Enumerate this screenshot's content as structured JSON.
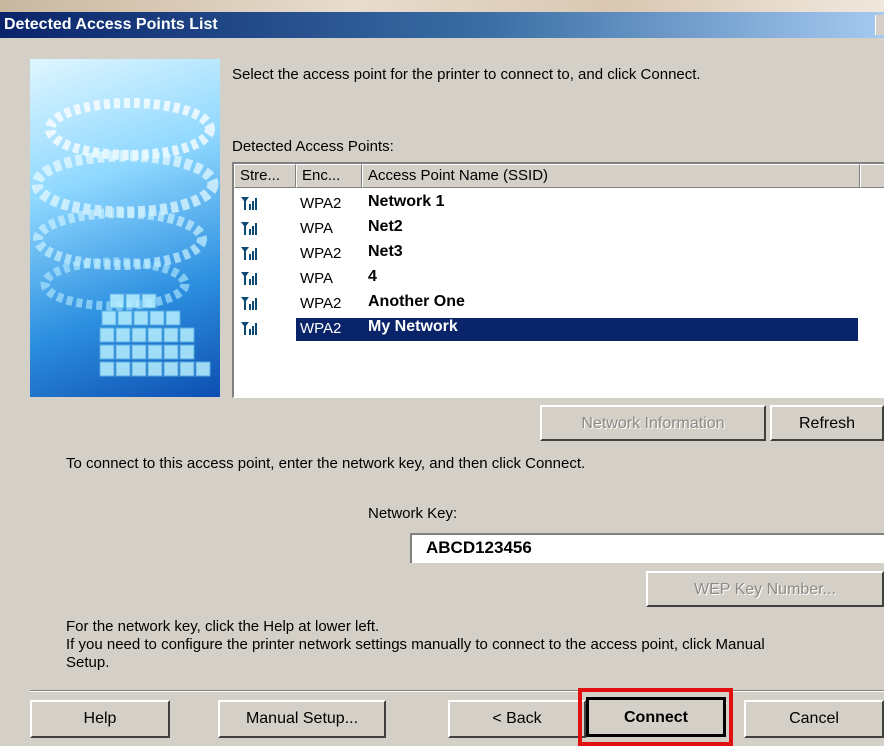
{
  "window": {
    "title": "Detected Access Points List"
  },
  "instructions": {
    "select": "Select the access point for the printer to connect to, and click Connect.",
    "detected_label": "Detected Access Points:",
    "enter_key": "To connect to this access point, enter the network key, and then click Connect.",
    "help_line1": "For the network key, click the Help at lower left.",
    "help_line2": "If you need to configure the printer network settings manually to connect to the access point, click Manual",
    "help_line3": "Setup."
  },
  "list": {
    "columns": [
      "Stre...",
      "Enc...",
      "Access Point Name (SSID)"
    ],
    "rows": [
      {
        "encryption": "WPA2",
        "ssid": "Network 1",
        "selected": false
      },
      {
        "encryption": "WPA",
        "ssid": "Net2",
        "selected": false
      },
      {
        "encryption": "WPA2",
        "ssid": "Net3",
        "selected": false
      },
      {
        "encryption": "WPA",
        "ssid": "4",
        "selected": false
      },
      {
        "encryption": "WPA2",
        "ssid": "Another One",
        "selected": false
      },
      {
        "encryption": "WPA2",
        "ssid": "My Network",
        "selected": true
      }
    ],
    "selection_color": "#0a246a",
    "signal_icon": "signal-strength-icon"
  },
  "buttons": {
    "network_info": "Network Information",
    "refresh": "Refresh",
    "wep_key": "WEP Key Number...",
    "help": "Help",
    "manual_setup": "Manual Setup...",
    "back": "< Back",
    "connect": "Connect",
    "cancel": "Cancel"
  },
  "network_key": {
    "label": "Network Key:",
    "value": "ABCD123456"
  },
  "colors": {
    "highlight_box": "#e01010",
    "dialog_bg": "#d4d0c8",
    "titlebar": "#0a246a"
  }
}
